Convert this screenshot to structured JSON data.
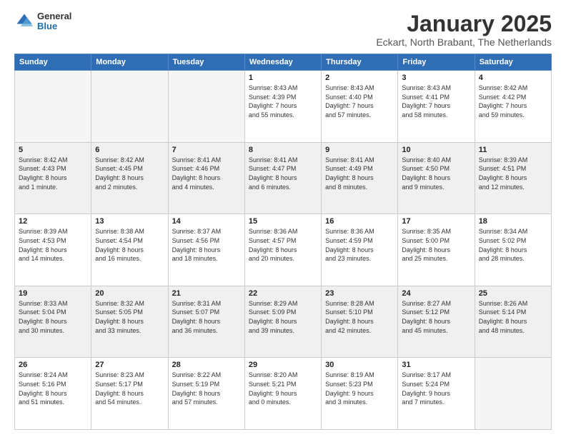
{
  "logo": {
    "general": "General",
    "blue": "Blue"
  },
  "title": "January 2025",
  "subtitle": "Eckart, North Brabant, The Netherlands",
  "days_header": [
    "Sunday",
    "Monday",
    "Tuesday",
    "Wednesday",
    "Thursday",
    "Friday",
    "Saturday"
  ],
  "weeks": [
    {
      "gray": false,
      "days": [
        {
          "num": "",
          "info": ""
        },
        {
          "num": "",
          "info": ""
        },
        {
          "num": "",
          "info": ""
        },
        {
          "num": "1",
          "info": "Sunrise: 8:43 AM\nSunset: 4:39 PM\nDaylight: 7 hours\nand 55 minutes."
        },
        {
          "num": "2",
          "info": "Sunrise: 8:43 AM\nSunset: 4:40 PM\nDaylight: 7 hours\nand 57 minutes."
        },
        {
          "num": "3",
          "info": "Sunrise: 8:43 AM\nSunset: 4:41 PM\nDaylight: 7 hours\nand 58 minutes."
        },
        {
          "num": "4",
          "info": "Sunrise: 8:42 AM\nSunset: 4:42 PM\nDaylight: 7 hours\nand 59 minutes."
        }
      ]
    },
    {
      "gray": true,
      "days": [
        {
          "num": "5",
          "info": "Sunrise: 8:42 AM\nSunset: 4:43 PM\nDaylight: 8 hours\nand 1 minute."
        },
        {
          "num": "6",
          "info": "Sunrise: 8:42 AM\nSunset: 4:45 PM\nDaylight: 8 hours\nand 2 minutes."
        },
        {
          "num": "7",
          "info": "Sunrise: 8:41 AM\nSunset: 4:46 PM\nDaylight: 8 hours\nand 4 minutes."
        },
        {
          "num": "8",
          "info": "Sunrise: 8:41 AM\nSunset: 4:47 PM\nDaylight: 8 hours\nand 6 minutes."
        },
        {
          "num": "9",
          "info": "Sunrise: 8:41 AM\nSunset: 4:49 PM\nDaylight: 8 hours\nand 8 minutes."
        },
        {
          "num": "10",
          "info": "Sunrise: 8:40 AM\nSunset: 4:50 PM\nDaylight: 8 hours\nand 9 minutes."
        },
        {
          "num": "11",
          "info": "Sunrise: 8:39 AM\nSunset: 4:51 PM\nDaylight: 8 hours\nand 12 minutes."
        }
      ]
    },
    {
      "gray": false,
      "days": [
        {
          "num": "12",
          "info": "Sunrise: 8:39 AM\nSunset: 4:53 PM\nDaylight: 8 hours\nand 14 minutes."
        },
        {
          "num": "13",
          "info": "Sunrise: 8:38 AM\nSunset: 4:54 PM\nDaylight: 8 hours\nand 16 minutes."
        },
        {
          "num": "14",
          "info": "Sunrise: 8:37 AM\nSunset: 4:56 PM\nDaylight: 8 hours\nand 18 minutes."
        },
        {
          "num": "15",
          "info": "Sunrise: 8:36 AM\nSunset: 4:57 PM\nDaylight: 8 hours\nand 20 minutes."
        },
        {
          "num": "16",
          "info": "Sunrise: 8:36 AM\nSunset: 4:59 PM\nDaylight: 8 hours\nand 23 minutes."
        },
        {
          "num": "17",
          "info": "Sunrise: 8:35 AM\nSunset: 5:00 PM\nDaylight: 8 hours\nand 25 minutes."
        },
        {
          "num": "18",
          "info": "Sunrise: 8:34 AM\nSunset: 5:02 PM\nDaylight: 8 hours\nand 28 minutes."
        }
      ]
    },
    {
      "gray": true,
      "days": [
        {
          "num": "19",
          "info": "Sunrise: 8:33 AM\nSunset: 5:04 PM\nDaylight: 8 hours\nand 30 minutes."
        },
        {
          "num": "20",
          "info": "Sunrise: 8:32 AM\nSunset: 5:05 PM\nDaylight: 8 hours\nand 33 minutes."
        },
        {
          "num": "21",
          "info": "Sunrise: 8:31 AM\nSunset: 5:07 PM\nDaylight: 8 hours\nand 36 minutes."
        },
        {
          "num": "22",
          "info": "Sunrise: 8:29 AM\nSunset: 5:09 PM\nDaylight: 8 hours\nand 39 minutes."
        },
        {
          "num": "23",
          "info": "Sunrise: 8:28 AM\nSunset: 5:10 PM\nDaylight: 8 hours\nand 42 minutes."
        },
        {
          "num": "24",
          "info": "Sunrise: 8:27 AM\nSunset: 5:12 PM\nDaylight: 8 hours\nand 45 minutes."
        },
        {
          "num": "25",
          "info": "Sunrise: 8:26 AM\nSunset: 5:14 PM\nDaylight: 8 hours\nand 48 minutes."
        }
      ]
    },
    {
      "gray": false,
      "days": [
        {
          "num": "26",
          "info": "Sunrise: 8:24 AM\nSunset: 5:16 PM\nDaylight: 8 hours\nand 51 minutes."
        },
        {
          "num": "27",
          "info": "Sunrise: 8:23 AM\nSunset: 5:17 PM\nDaylight: 8 hours\nand 54 minutes."
        },
        {
          "num": "28",
          "info": "Sunrise: 8:22 AM\nSunset: 5:19 PM\nDaylight: 8 hours\nand 57 minutes."
        },
        {
          "num": "29",
          "info": "Sunrise: 8:20 AM\nSunset: 5:21 PM\nDaylight: 9 hours\nand 0 minutes."
        },
        {
          "num": "30",
          "info": "Sunrise: 8:19 AM\nSunset: 5:23 PM\nDaylight: 9 hours\nand 3 minutes."
        },
        {
          "num": "31",
          "info": "Sunrise: 8:17 AM\nSunset: 5:24 PM\nDaylight: 9 hours\nand 7 minutes."
        },
        {
          "num": "",
          "info": ""
        }
      ]
    }
  ]
}
